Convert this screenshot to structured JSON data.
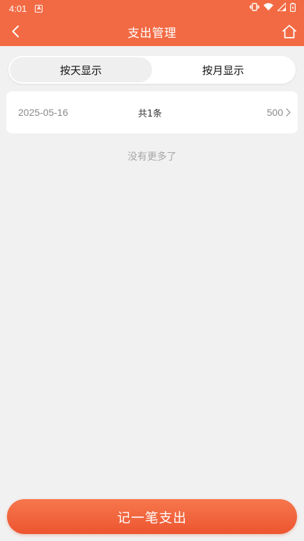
{
  "status_bar": {
    "time": "4:01",
    "app_icon_letter": "A"
  },
  "header": {
    "title": "支出管理",
    "background": "#f26a43"
  },
  "tabs": [
    {
      "label": "按天显示",
      "active": true
    },
    {
      "label": "按月显示",
      "active": false
    }
  ],
  "records": [
    {
      "date": "2025-05-16",
      "count": "共1条",
      "amount": "500"
    }
  ],
  "list_footer": "没有更多了",
  "add_button": {
    "label": "记一笔支出",
    "color": "#ec5530"
  }
}
